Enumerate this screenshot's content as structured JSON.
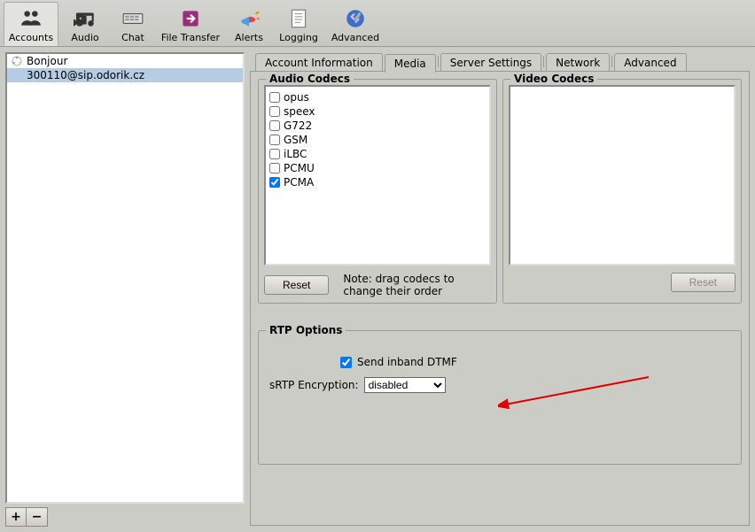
{
  "toolbar": {
    "items": [
      {
        "label": "Accounts",
        "active": true,
        "icon": "accounts"
      },
      {
        "label": "Audio",
        "active": false,
        "icon": "audio"
      },
      {
        "label": "Chat",
        "active": false,
        "icon": "chat"
      },
      {
        "label": "File Transfer",
        "active": false,
        "icon": "filetransfer"
      },
      {
        "label": "Alerts",
        "active": false,
        "icon": "alerts"
      },
      {
        "label": "Logging",
        "active": false,
        "icon": "logging"
      },
      {
        "label": "Advanced",
        "active": false,
        "icon": "advanced"
      }
    ]
  },
  "sidebar": {
    "accounts": [
      {
        "label": "Bonjour",
        "selected": false,
        "icon": "bonjour"
      },
      {
        "label": "300110@sip.odorik.cz",
        "selected": true,
        "icon": "none"
      }
    ],
    "add_label": "+",
    "remove_label": "−"
  },
  "tabs": {
    "items": [
      {
        "label": "Account Information",
        "active": false
      },
      {
        "label": "Media",
        "active": true
      },
      {
        "label": "Server Settings",
        "active": false
      },
      {
        "label": "Network",
        "active": false
      },
      {
        "label": "Advanced",
        "active": false
      }
    ]
  },
  "media": {
    "audio_title": "Audio Codecs",
    "video_title": "Video Codecs",
    "audio_codecs": [
      {
        "label": "opus",
        "checked": false
      },
      {
        "label": "speex",
        "checked": false
      },
      {
        "label": "G722",
        "checked": false
      },
      {
        "label": "GSM",
        "checked": false
      },
      {
        "label": "iLBC",
        "checked": false
      },
      {
        "label": "PCMU",
        "checked": false
      },
      {
        "label": "PCMA",
        "checked": true
      }
    ],
    "video_codecs": [],
    "reset_label": "Reset",
    "note": "Note: drag codecs to change their order",
    "reset2_label": "Reset"
  },
  "rtp": {
    "title": "RTP Options",
    "inband_label": "Send inband DTMF",
    "inband_checked": true,
    "srtp_label": "sRTP Encryption:",
    "srtp_value": "disabled"
  }
}
